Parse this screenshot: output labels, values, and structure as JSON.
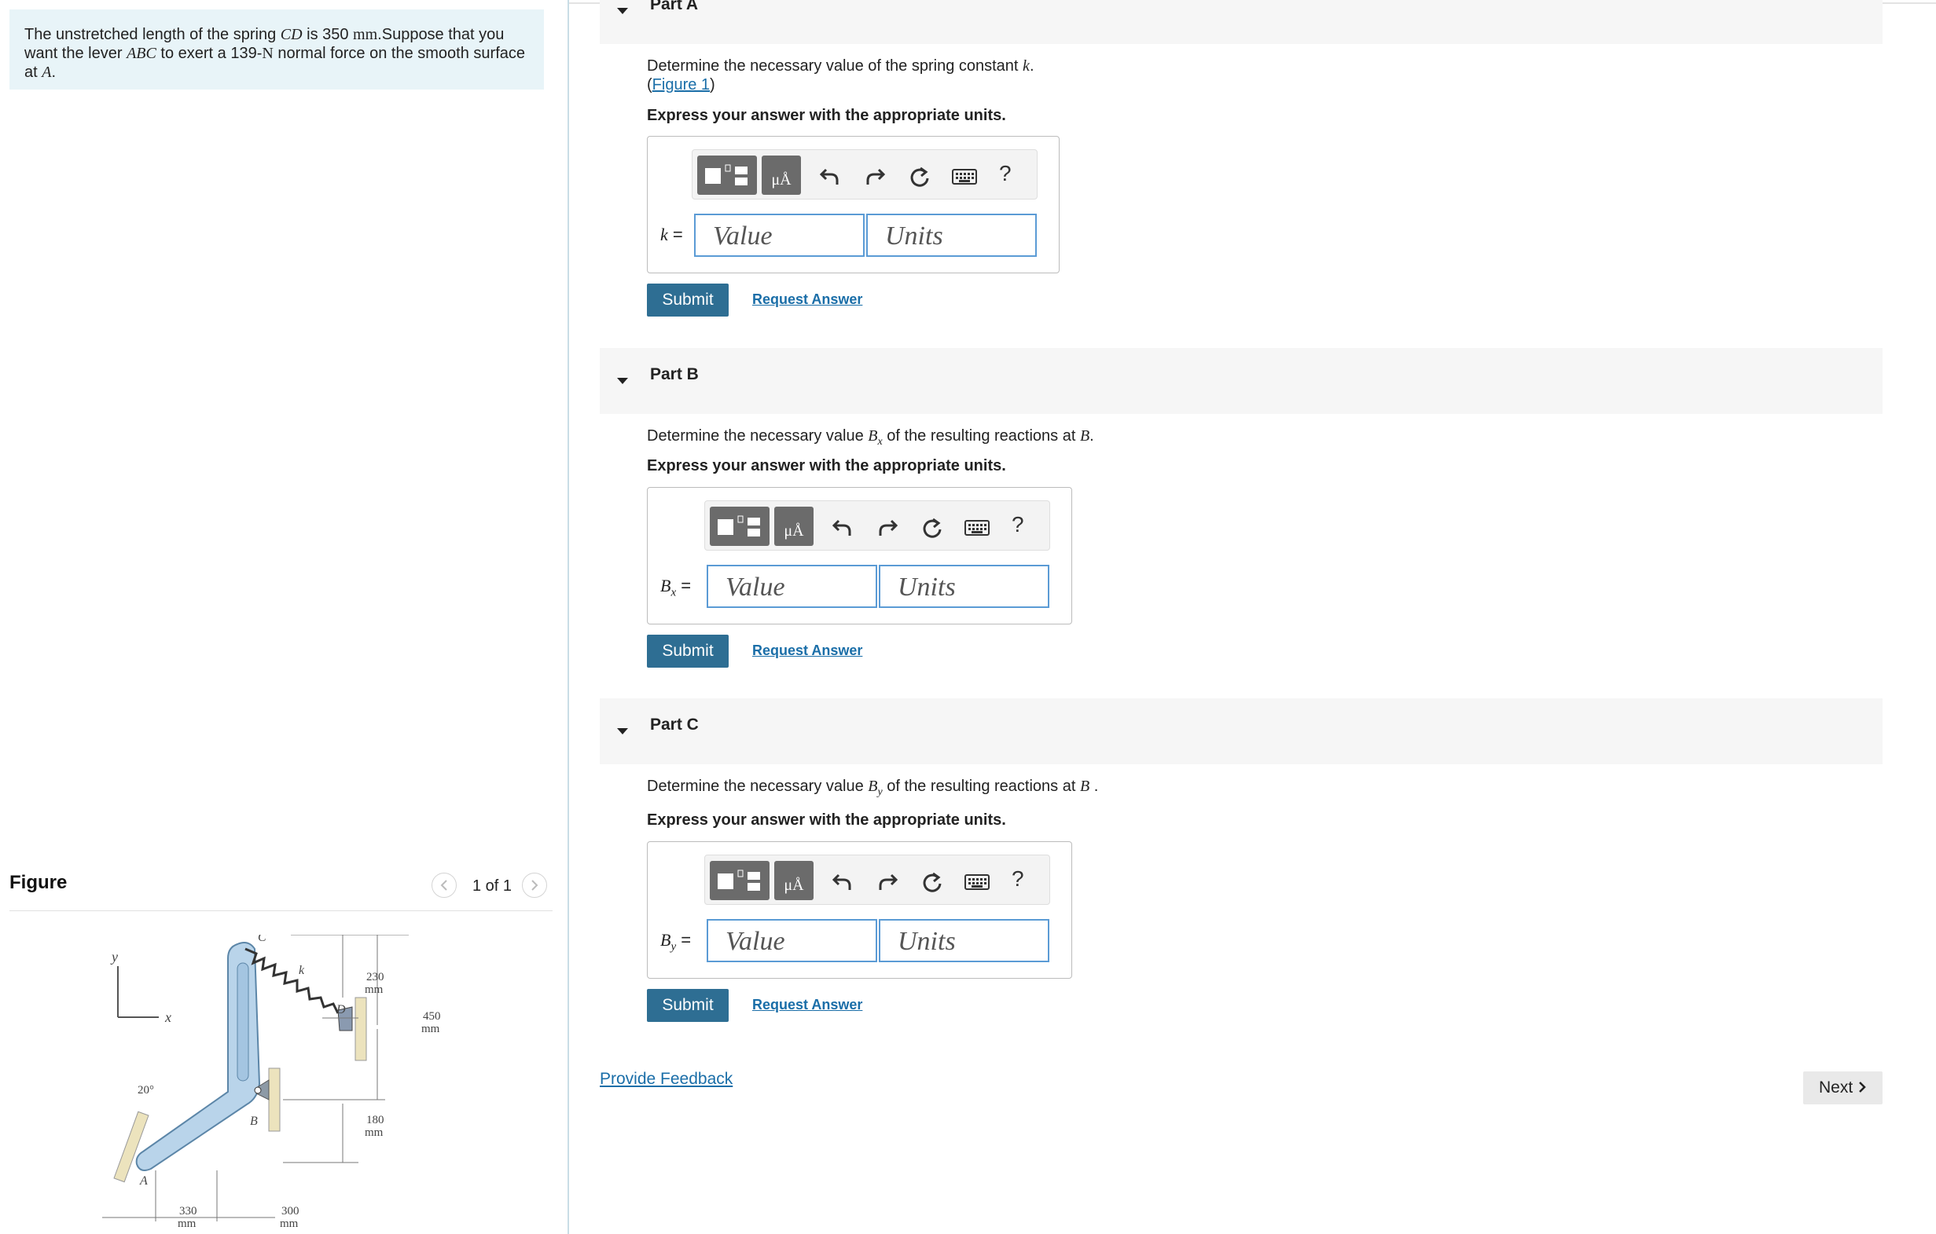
{
  "problem": {
    "intro_1": "The unstretched length of the spring ",
    "spring": "CD",
    "intro_2": " is 350 ",
    "length_unit": "mm",
    "intro_3": ".Suppose that you want the lever ",
    "lever": "ABC",
    "intro_4": " to exert a 139-",
    "force_unit": "N",
    "intro_5": " normal force on the smooth surface at ",
    "point": "A",
    "intro_6": "."
  },
  "figure": {
    "title": "Figure",
    "pager": "1 of 1",
    "labels": {
      "C": "C",
      "k": "k",
      "D": "D",
      "B": "B",
      "A": "A",
      "x": "x",
      "y": "y",
      "angle": "20°",
      "dim_230": "230",
      "dim_450": "450",
      "dim_180": "180",
      "dim_330": "330",
      "dim_300": "300",
      "unit": "mm"
    }
  },
  "parts": [
    {
      "label": "Part A",
      "q_pre": "Determine the necessary value of the spring constant ",
      "q_sym": "k",
      "q_post": ".",
      "fig_link_open": "(",
      "fig_link": "Figure 1",
      "fig_link_close": ")",
      "instruction": "Express your answer with the appropriate units.",
      "eq_sym": "k",
      "eq_sub": "",
      "eq_sign": " =",
      "value_placeholder": "Value",
      "units_placeholder": "Units",
      "submit": "Submit",
      "request": "Request Answer"
    },
    {
      "label": "Part B",
      "q_pre": "Determine the necessary value ",
      "q_sym": "B",
      "q_sub": "x",
      "q_post": " of the resulting reactions at ",
      "q_sym2": "B",
      "q_end": ".",
      "instruction": "Express your answer with the appropriate units.",
      "eq_sym": "B",
      "eq_sub": "x",
      "eq_sign": " =",
      "value_placeholder": "Value",
      "units_placeholder": "Units",
      "submit": "Submit",
      "request": "Request Answer"
    },
    {
      "label": "Part C",
      "q_pre": "Determine the necessary value ",
      "q_sym": "B",
      "q_sub": "y",
      "q_post": " of the resulting reactions at ",
      "q_sym2": "B",
      "q_end": " .",
      "instruction": "Express your answer with the appropriate units.",
      "eq_sym": "B",
      "eq_sub": "y",
      "eq_sign": " =",
      "value_placeholder": "Value",
      "units_placeholder": "Units",
      "submit": "Submit",
      "request": "Request Answer"
    }
  ],
  "toolbar": {
    "units_icon_text": "μÅ",
    "help": "?"
  },
  "footer": {
    "feedback": "Provide Feedback",
    "next": "Next"
  },
  "colors": {
    "accent": "#2e6e93",
    "link": "#1a6ea8",
    "problem_bg": "#e8f4f8",
    "field_border": "#5b9bd5",
    "lever_fill": "#b9d4ea"
  }
}
